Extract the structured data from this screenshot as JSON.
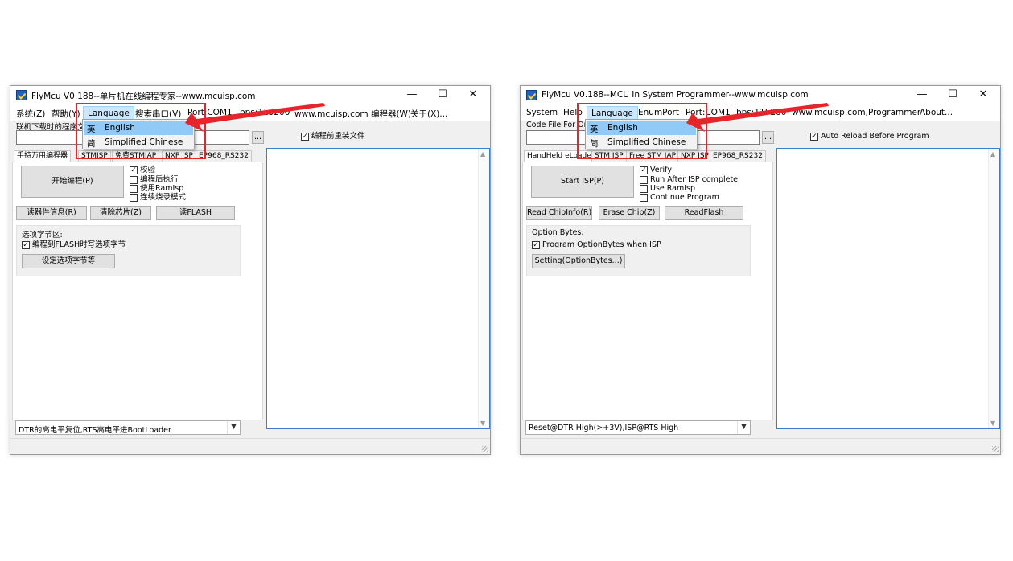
{
  "cn_window": {
    "title": "FlyMcu V0.188--单片机在线编程专家--www.mcuisp.com",
    "caption": {
      "minimize": "—",
      "maximize": "☐",
      "close": "✕"
    },
    "menu": [
      "系统(Z)",
      "帮助(Y)",
      "Language",
      "搜索串口(V)",
      "Port:COM1",
      "bps:115200",
      "www.mcuisp.com 编程器(W)",
      "关于(X)..."
    ],
    "code_file_label": "联机下载时的程序文件:",
    "browse_label": "...",
    "reload_label": "编程前重装文件",
    "tabs": [
      "手持万用编程器",
      "STMISP",
      "免费STMIAP",
      "NXP ISP",
      "EP968_RS232"
    ],
    "start_button": "开始编程(P)",
    "checks": [
      "校验",
      "编程后执行",
      "使用RamIsp",
      "连续烧录模式"
    ],
    "read_info_button": "读器件信息(R)",
    "erase_button": "清除芯片(Z)",
    "read_flash_button": "读FLASH",
    "option_title": "选项字节区:",
    "option_check": "编程到FLASH时写选项字节",
    "option_button": "设定选项字节等",
    "reset_mode": "DTR的高电平复位,RTS高电平进BootLoader",
    "dropdown": [
      {
        "icon": "英",
        "label": "English"
      },
      {
        "icon": "简",
        "label": "Simplified Chinese"
      }
    ]
  },
  "en_window": {
    "title": "FlyMcu V0.188--MCU In System Programmer--www.mcuisp.com",
    "caption": {
      "minimize": "—",
      "maximize": "☐",
      "close": "✕"
    },
    "menu": [
      "System",
      "Help",
      "Language",
      "EnumPort",
      "Port:COM1",
      "bps:115200",
      "www.mcuisp.com,Programmer",
      "About..."
    ],
    "code_file_label": "Code File For Online ISP:",
    "browse_label": "...",
    "reload_label": "Auto Reload Before Program",
    "tabs": [
      "HandHeld eLoader",
      "STM ISP",
      "Free STM IAP",
      "NXP ISP",
      "EP968_RS232"
    ],
    "start_button": "Start ISP(P)",
    "checks": [
      "Verify",
      "Run After ISP complete",
      "Use RamIsp",
      "Continue Program"
    ],
    "read_info_button": "Read ChipInfo(R)",
    "erase_button": "Erase Chip(Z)",
    "read_flash_button": "ReadFlash",
    "option_title": "Option Bytes:",
    "option_check": "Program OptionBytes when ISP",
    "option_button": "Setting(OptionBytes...)",
    "reset_mode": "Reset@DTR High(>+3V),ISP@RTS High",
    "dropdown": [
      {
        "icon": "英",
        "label": "English"
      },
      {
        "icon": "简",
        "label": "Simplified Chinese"
      }
    ]
  },
  "check_states": {
    "cn": [
      true,
      false,
      false,
      false
    ],
    "en": [
      true,
      false,
      false,
      false
    ],
    "reload": true,
    "option_check": true
  },
  "colors": {
    "highlight_box": "#e8242b",
    "selected_item": "#91c9f7",
    "menu_hover": "#cce8ff",
    "log_border": "#3c7fd1"
  }
}
